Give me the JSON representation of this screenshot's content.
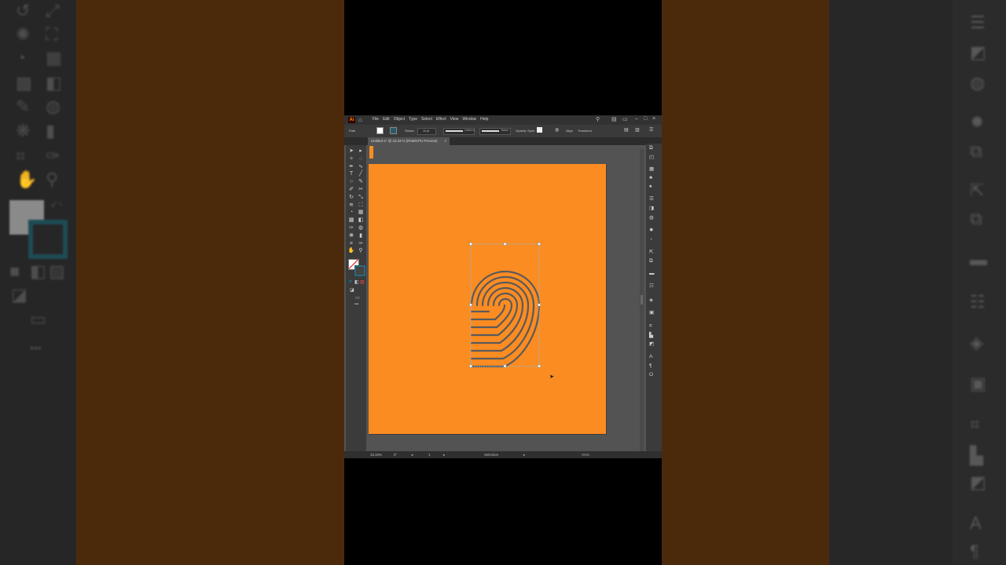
{
  "app": {
    "logo_text": "Ai",
    "menu": [
      "File",
      "Edit",
      "Object",
      "Type",
      "Select",
      "Effect",
      "View",
      "Window",
      "Help"
    ]
  },
  "control_bar": {
    "selection_label": "Path",
    "stroke_label": "Stroke:",
    "stroke_value": "10 pt",
    "brush_label": "Uniform",
    "profile_label": "Basic",
    "opacity_label": "Opacity",
    "style_label": "Style:",
    "align_label": "Align",
    "transform_label": "Transform"
  },
  "document_tab": {
    "title": "Untitled-1* @ 33.33 % (RGB/CPU Preview)",
    "close": "×"
  },
  "status_bar": {
    "zoom": "33.33%",
    "rotation": "0°",
    "artboard_number": "1",
    "tool": "Selection"
  },
  "colors": {
    "artboard": "#fb8c22",
    "stroke": "#5a5a5a",
    "ui_dark": "#323232"
  },
  "icons": {
    "home": "home-icon",
    "search": "search-icon",
    "minimize": "minimize-icon",
    "maximize": "maximize-icon",
    "close": "close-icon",
    "cursor": "arrow-cursor-icon"
  }
}
